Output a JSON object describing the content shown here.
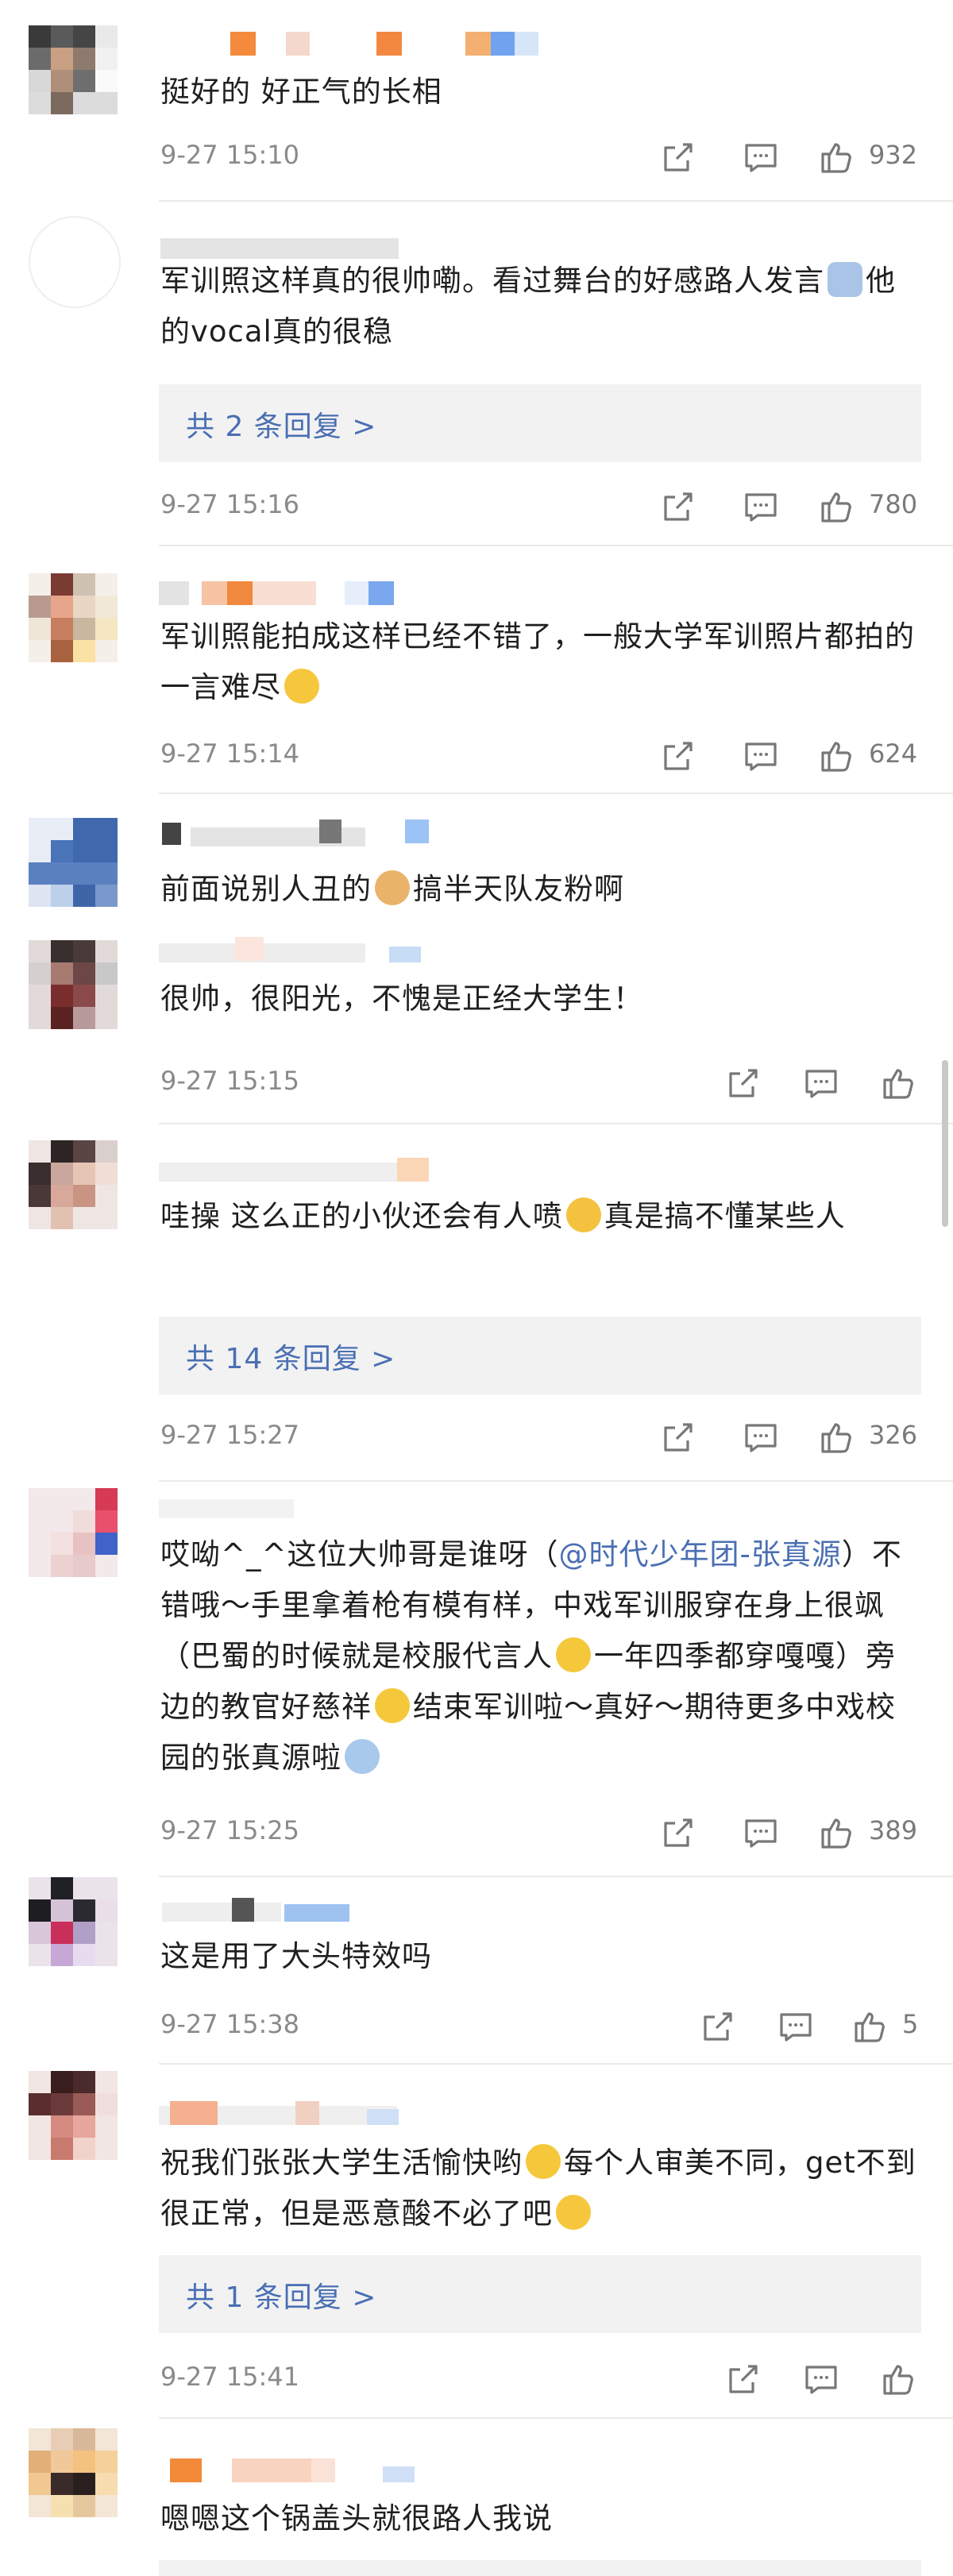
{
  "comments": [
    {
      "text": "挺好的 好正气的长相",
      "time": "9-27 15:10",
      "likes": "932"
    },
    {
      "text_parts": [
        "军训照这样真的很帅嘞。看过舞台的好感路人发言",
        "他的vocal真的很稳"
      ],
      "replies": "共 2 条回复 >",
      "time": "9-27 15:16",
      "likes": "780"
    },
    {
      "text_parts": [
        "军训照能拍成这样已经不错了，一般大学军训照片都拍的一言难尽",
        ""
      ],
      "time": "9-27 15:14",
      "likes": "624"
    },
    {
      "text_parts": [
        "前面说别人丑的",
        "搞半天队友粉啊"
      ]
    },
    {
      "text": "很帅，很阳光，不愧是正经大学生！",
      "time": "9-27 15:15",
      "likes": ""
    },
    {
      "text_parts": [
        "哇操 这么正的小伙还会有人喷",
        "真是搞不懂某些人"
      ],
      "replies": "共 14 条回复 >",
      "time": "9-27 15:27",
      "likes": "326"
    },
    {
      "text_parts": [
        "哎呦^_^这位大帅哥是谁呀（",
        "@时代少年团-张真源",
        "）不错哦～手里拿着枪有模有样，中戏军训服穿在身上很飒（巴蜀的时候就是校服代言人",
        "一年四季都穿嘎嘎）旁边的教官好慈祥",
        "结束军训啦～真好～期待更多中戏校园的张真源啦",
        ""
      ],
      "time": "9-27 15:25",
      "likes": "389"
    },
    {
      "text": "这是用了大头特效吗",
      "time": "9-27 15:38",
      "likes": "5"
    },
    {
      "text_parts": [
        "祝我们张张大学生活愉快哟",
        "每个人审美不同，get不到很正常，但是恶意酸不必了吧",
        ""
      ],
      "replies": "共 1 条回复 >",
      "time": "9-27 15:41",
      "likes": ""
    },
    {
      "text": "嗯嗯这个锅盖头就很路人我说"
    }
  ],
  "icons": [
    "share-icon",
    "comment-icon",
    "like-icon"
  ]
}
